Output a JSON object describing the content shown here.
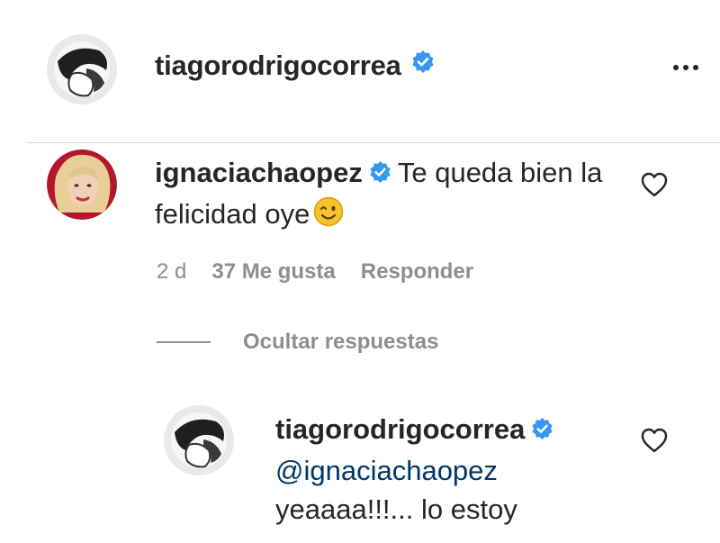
{
  "post": {
    "author": "tiagorodrigocorrea",
    "author_verified": true,
    "more_icon": "more-horizontal-icon"
  },
  "comment": {
    "username": "ignaciachaopez",
    "verified": true,
    "text": "Te queda bien la felicidad oye",
    "emoji": "winking-face-emoji",
    "time": "2 d",
    "likes": "37 Me gusta",
    "reply_label": "Responder",
    "like_icon": "heart-outline-icon",
    "replies_toggle_label": "Ocultar respuestas"
  },
  "reply": {
    "username": "tiagorodrigocorrea",
    "verified": true,
    "mention": "@ignaciachaopez",
    "text": "yeaaaa!!!... lo estoy",
    "like_icon": "heart-outline-icon"
  },
  "colors": {
    "verified_badge": "#3897f0",
    "secondary_text": "#8e8e8e",
    "primary_text": "#262626",
    "mention": "#00376b",
    "divider": "#dbdbdb"
  }
}
